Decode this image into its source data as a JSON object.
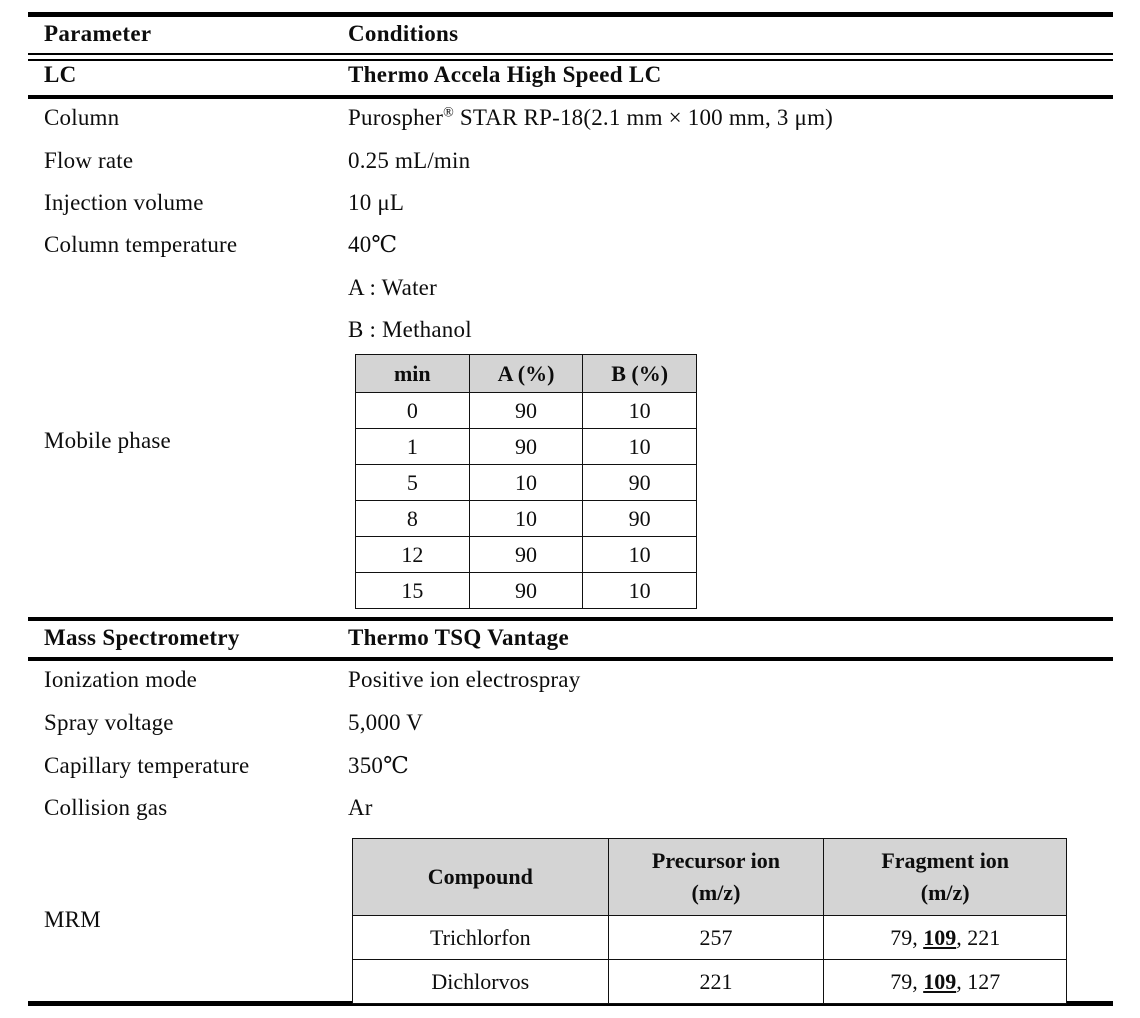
{
  "table": {
    "header": {
      "parameter": "Parameter",
      "conditions": "Conditions"
    },
    "sections": [
      {
        "name": "LC",
        "instrument": "Thermo Accela High Speed LC"
      },
      {
        "name": "Mass Spectrometry",
        "instrument": "Thermo TSQ Vantage"
      }
    ],
    "lc_rows": {
      "column_label": "Column",
      "column_value_pre": "Purospher",
      "column_value_sup": "®",
      "column_value_post": " STAR RP-18(2.1 mm × 100 mm, 3 μm)",
      "flow_rate_label": "Flow rate",
      "flow_rate_value": "0.25 mL/min",
      "injection_volume_label": "Injection volume",
      "injection_volume_value": "10 μL",
      "column_temperature_label": "Column temperature",
      "column_temperature_value": "40℃",
      "mobile_phase_label": "Mobile phase",
      "mobile_phase_a": "A : Water",
      "mobile_phase_b": "B : Methanol"
    },
    "ms_rows": {
      "ionization_mode_label": "Ionization mode",
      "ionization_mode_value": "Positive ion electrospray",
      "spray_voltage_label": "Spray voltage",
      "spray_voltage_value": "5,000 V",
      "capillary_temperature_label": "Capillary temperature",
      "capillary_temperature_value": "350℃",
      "collision_gas_label": "Collision gas",
      "collision_gas_value": "Ar",
      "mrm_label": "MRM"
    }
  },
  "gradient_table": {
    "columns": [
      "min",
      "A (%)",
      "B (%)"
    ],
    "rows": [
      {
        "min": "0",
        "a": "90",
        "b": "10"
      },
      {
        "min": "1",
        "a": "90",
        "b": "10"
      },
      {
        "min": "5",
        "a": "10",
        "b": "90"
      },
      {
        "min": "8",
        "a": "10",
        "b": "90"
      },
      {
        "min": "12",
        "a": "90",
        "b": "10"
      },
      {
        "min": "15",
        "a": "90",
        "b": "10"
      }
    ]
  },
  "mrm_table": {
    "columns": {
      "compound": "Compound",
      "precursor_line1": "Precursor ion",
      "precursor_line2": "(m/z)",
      "fragment_line1": "Fragment ion",
      "fragment_line2": "(m/z)"
    },
    "rows": [
      {
        "compound": "Trichlorfon",
        "precursor": "257",
        "fragment_pre": "79, ",
        "fragment_bold": "109",
        "fragment_post": ", 221"
      },
      {
        "compound": "Dichlorvos",
        "precursor": "221",
        "fragment_pre": "79, ",
        "fragment_bold": "109",
        "fragment_post": ", 127"
      }
    ]
  },
  "colors": {
    "header_fill": "#d4d4d4",
    "rule": "#000000",
    "text": "#0d0d0d"
  }
}
